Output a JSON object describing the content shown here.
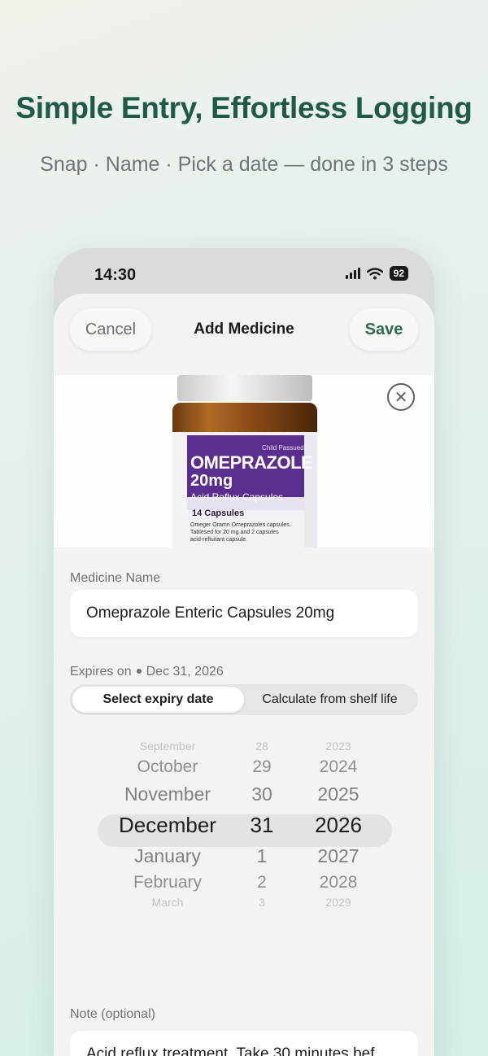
{
  "marketing": {
    "headline": "Simple Entry, Effortless Logging",
    "subline": "Snap · Name · Pick a date — done in 3 steps"
  },
  "status_bar": {
    "time": "14:30",
    "battery": "92",
    "icons": [
      "signal-icon",
      "wifi-icon",
      "battery-icon"
    ]
  },
  "nav": {
    "cancel_label": "Cancel",
    "title": "Add Medicine",
    "save_label": "Save"
  },
  "photo": {
    "close_icon": "close-circle-icon",
    "label": {
      "brand": "OMEPRAZOLE",
      "strength": "20mg",
      "type": "Acid Reflux Capsules",
      "count": "14 Capsules",
      "tag": "Child Passued",
      "fine_print": [
        "Omeger Oramn Omeprazoles capsules.",
        "Tablesed for 20 mg and 2 capsules",
        "acid-refluitant capsule."
      ]
    }
  },
  "medicine_name": {
    "label": "Medicine Name",
    "value": "Omeprazole Enteric Capsules 20mg"
  },
  "expiry": {
    "label": "Expires on",
    "date": "Dec 31, 2026",
    "segments": [
      "Select expiry date",
      "Calculate from shelf life"
    ],
    "selected_segment": "Select expiry date"
  },
  "picker": {
    "months": [
      "September",
      "October",
      "November",
      "December",
      "January",
      "February",
      "March"
    ],
    "days": [
      "28",
      "29",
      "30",
      "31",
      "1",
      "2",
      "3"
    ],
    "years": [
      "2023",
      "2024",
      "2025",
      "2026",
      "2027",
      "2028",
      "2029"
    ],
    "selected": {
      "month": "December",
      "day": "31",
      "year": "2026"
    }
  },
  "note": {
    "label": "Note (optional)",
    "value": "Acid reflux treatment. Take 30 minutes bef..."
  },
  "colors": {
    "accent": "#2e6b4f",
    "headline": "#1f5a46",
    "label_purple": "#5b2d8e"
  }
}
